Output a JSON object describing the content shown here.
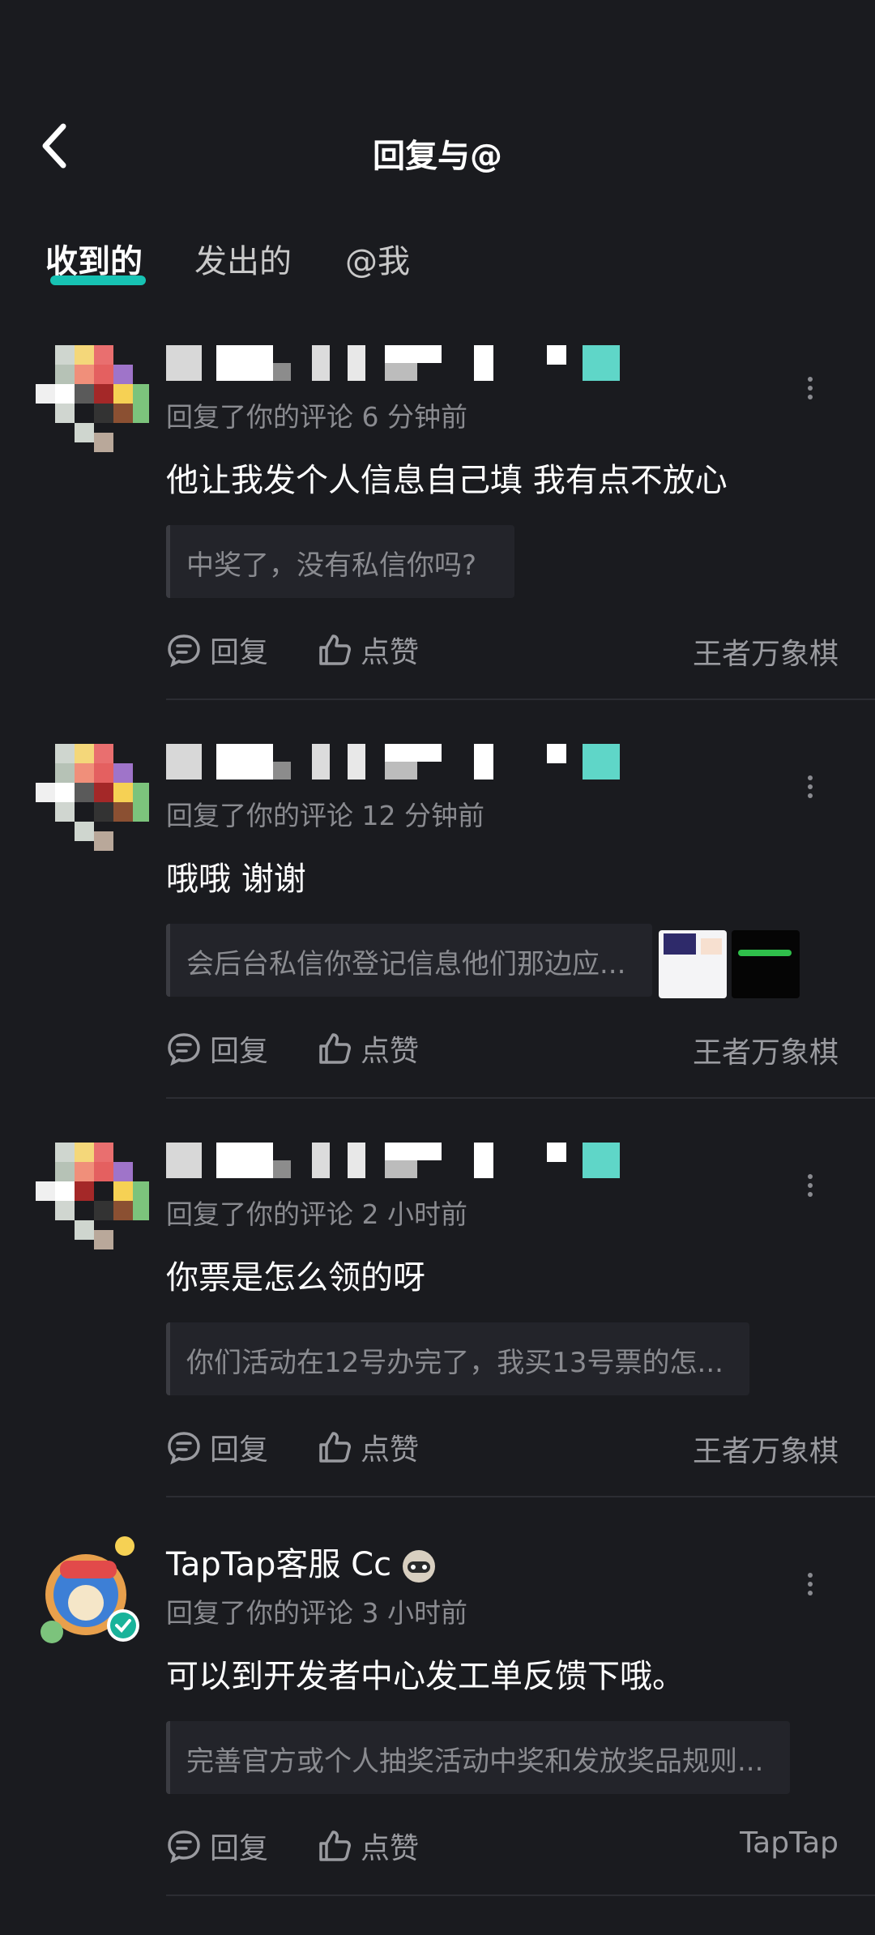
{
  "header": {
    "title": "回复与@",
    "back_label": "<"
  },
  "tabs": [
    {
      "label": "收到的",
      "active": true
    },
    {
      "label": "发出的",
      "active": false
    },
    {
      "label": "@我",
      "active": false
    }
  ],
  "comments": [
    {
      "name": "",
      "meta": "回复了你的评论 6 分钟前",
      "text": "他让我发个人信息自己填 我有点不放心",
      "quote": "中奖了，没有私信你吗?",
      "reply_label": "回复",
      "like_label": "点赞",
      "tag": "王者万象棋"
    },
    {
      "name": "",
      "meta": "回复了你的评论 12 分钟前",
      "text": "哦哦 谢谢",
      "quote": "会后台私信你登记信息他们那边应...",
      "reply_label": "回复",
      "like_label": "点赞",
      "tag": "王者万象棋"
    },
    {
      "name": "",
      "meta": "回复了你的评论 2 小时前",
      "text": "你票是怎么领的呀",
      "quote": "你们活动在12号办完了，我买13号票的怎...",
      "reply_label": "回复",
      "like_label": "点赞",
      "tag": "王者万象棋"
    },
    {
      "name": "TapTap客服 Cc",
      "meta": "回复了你的评论 3 小时前",
      "text": "可以到开发者中心发工单反馈下哦。",
      "quote": "完善官方或个人抽奖活动中奖和发放奖品规则...",
      "reply_label": "回复",
      "like_label": "点赞",
      "tag": "TapTap"
    }
  ],
  "colors": {
    "accent": "#17c2b3",
    "background": "#1a1b1f"
  }
}
